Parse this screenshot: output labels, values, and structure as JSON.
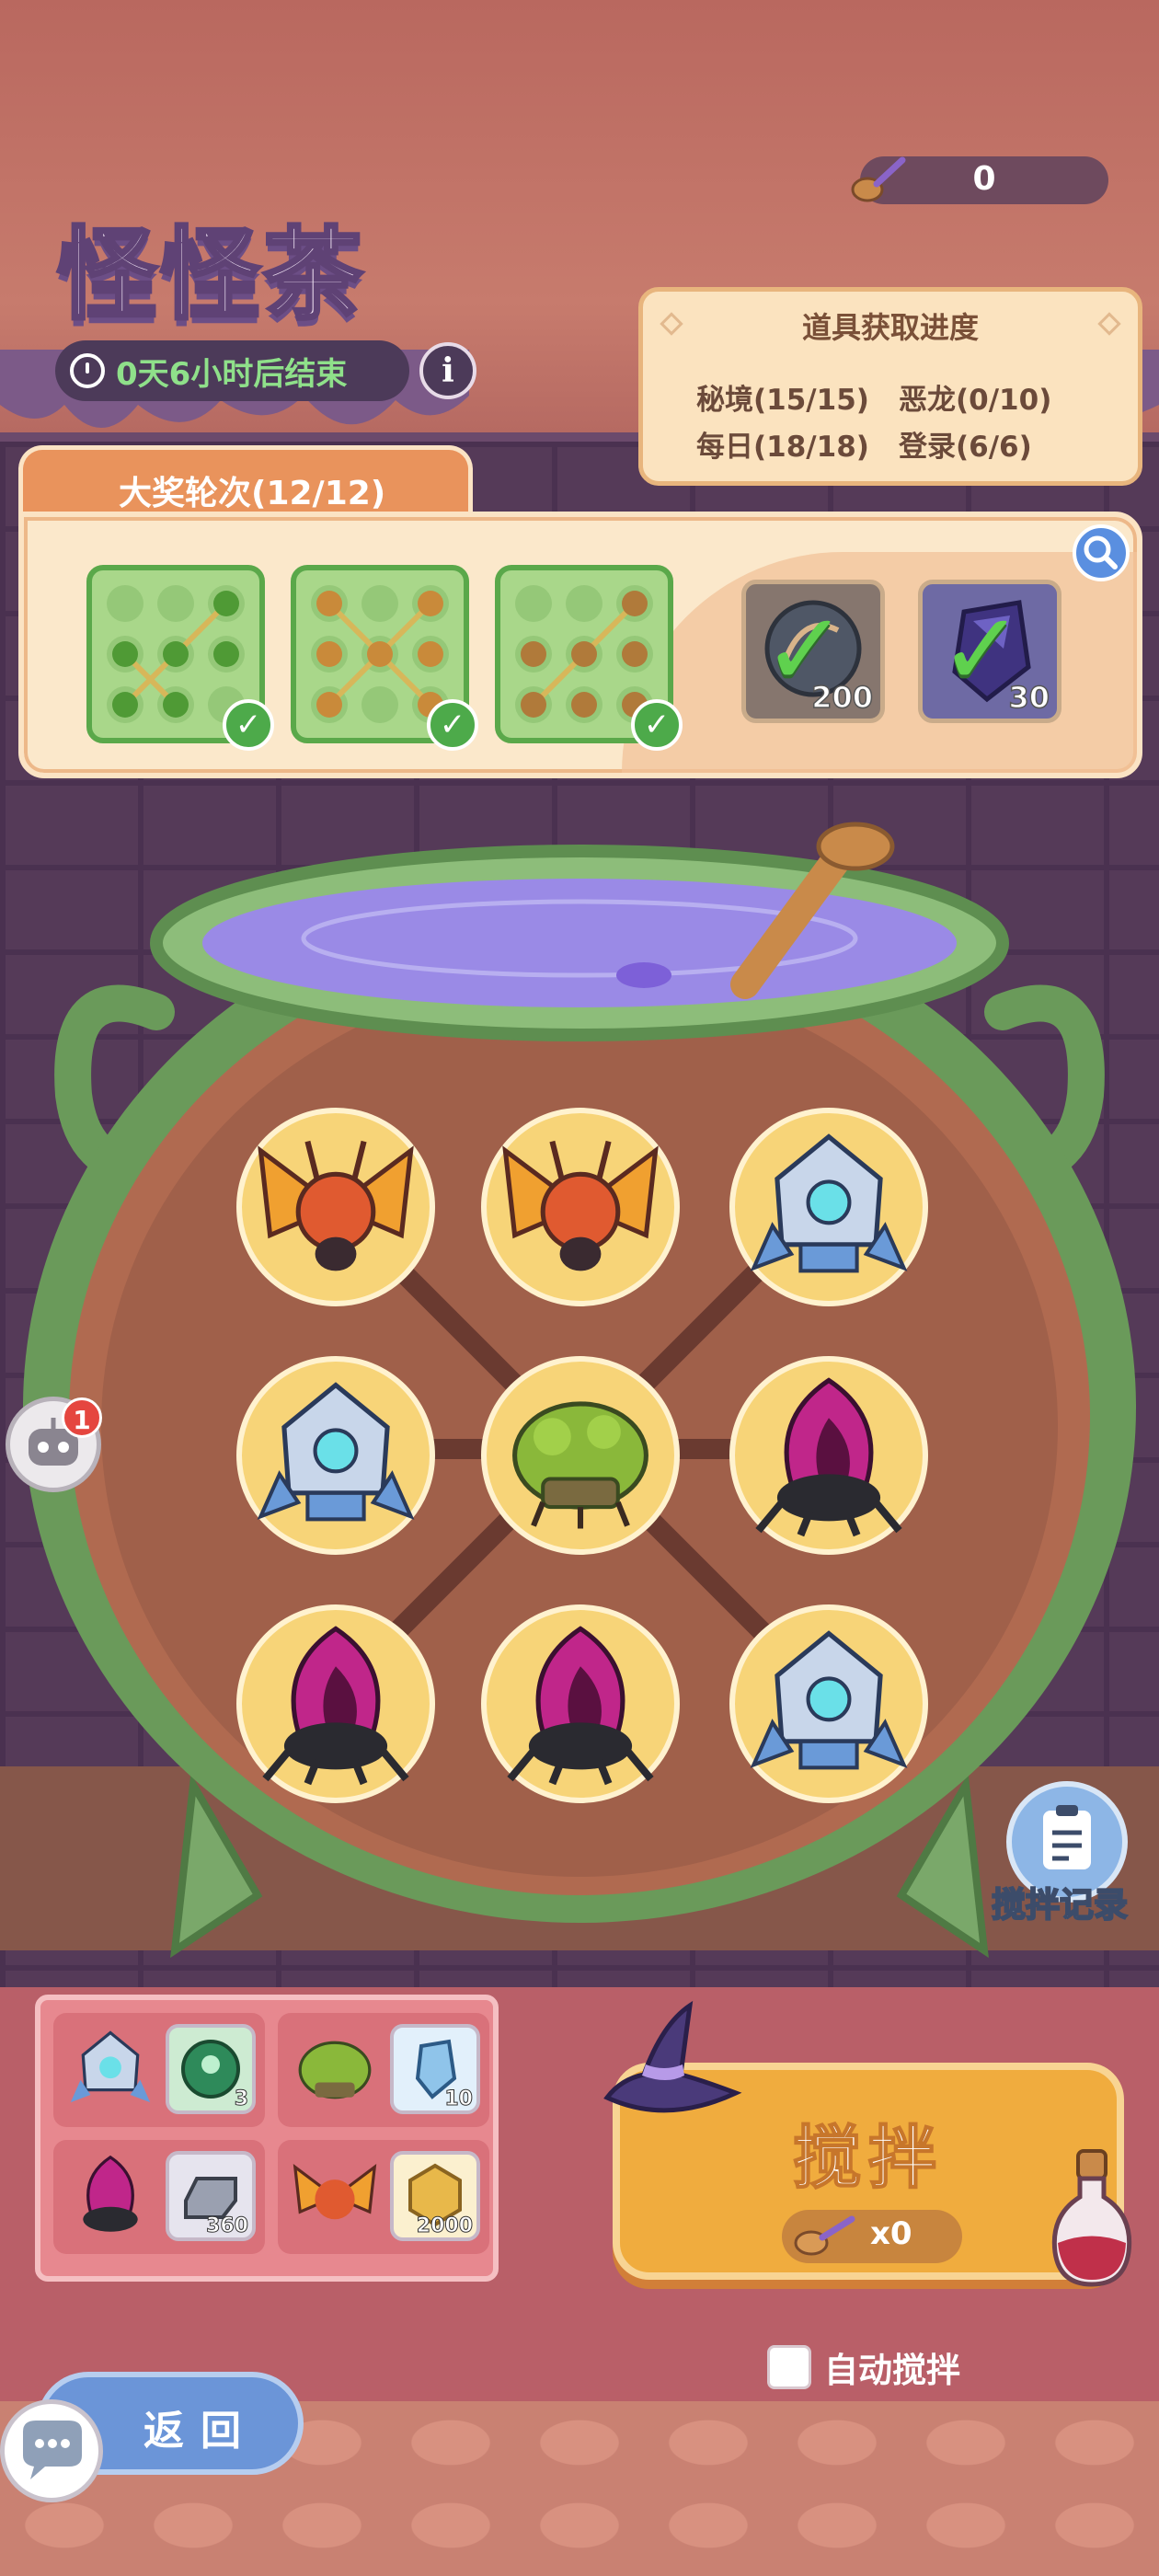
{
  "header": {
    "title": "怪怪茶",
    "timer_text": "0天6小时后结束",
    "info_label": "i",
    "spoon_count": "0"
  },
  "progress_panel": {
    "title": "道具获取进度",
    "items": [
      "秘境(15/15)",
      "恶龙(0/10)",
      "每日(18/18)",
      "登录(6/6)"
    ]
  },
  "grand_prize": {
    "tab_label": "大奖轮次(12/12)",
    "boards_completed": 3,
    "rewards": [
      {
        "icon": "stone-ring-icon",
        "count": "200",
        "collected": true
      },
      {
        "icon": "purple-crystal-icon",
        "count": "30",
        "collected": true
      }
    ]
  },
  "cauldron": {
    "grid": [
      [
        "fire-moth",
        "fire-moth",
        "ice-golem"
      ],
      [
        "ice-golem",
        "moss-beetle",
        "shadow-spider"
      ],
      [
        "shadow-spider",
        "shadow-spider",
        "ice-golem"
      ]
    ]
  },
  "side": {
    "chat_badge": "1",
    "stir_record_label": "搅拌记录"
  },
  "reward_list": [
    {
      "monster": "ice-golem",
      "item": "green-emblem-icon",
      "count": "3"
    },
    {
      "monster": "moss-beetle",
      "item": "blue-crystal-icon",
      "count": "10"
    },
    {
      "monster": "shadow-spider",
      "item": "silver-ingot-icon",
      "count": "360"
    },
    {
      "monster": "fire-moth",
      "item": "gold-coin-icon",
      "count": "2000"
    }
  ],
  "stir": {
    "label": "搅拌",
    "cost": "x0"
  },
  "auto_stir": {
    "label": "自动搅拌",
    "checked": false
  },
  "back": {
    "label": "返回"
  },
  "colors": {
    "accent_orange": "#f0ac3e",
    "board_green": "#5aa84a",
    "timer_green": "#8fe08a"
  }
}
